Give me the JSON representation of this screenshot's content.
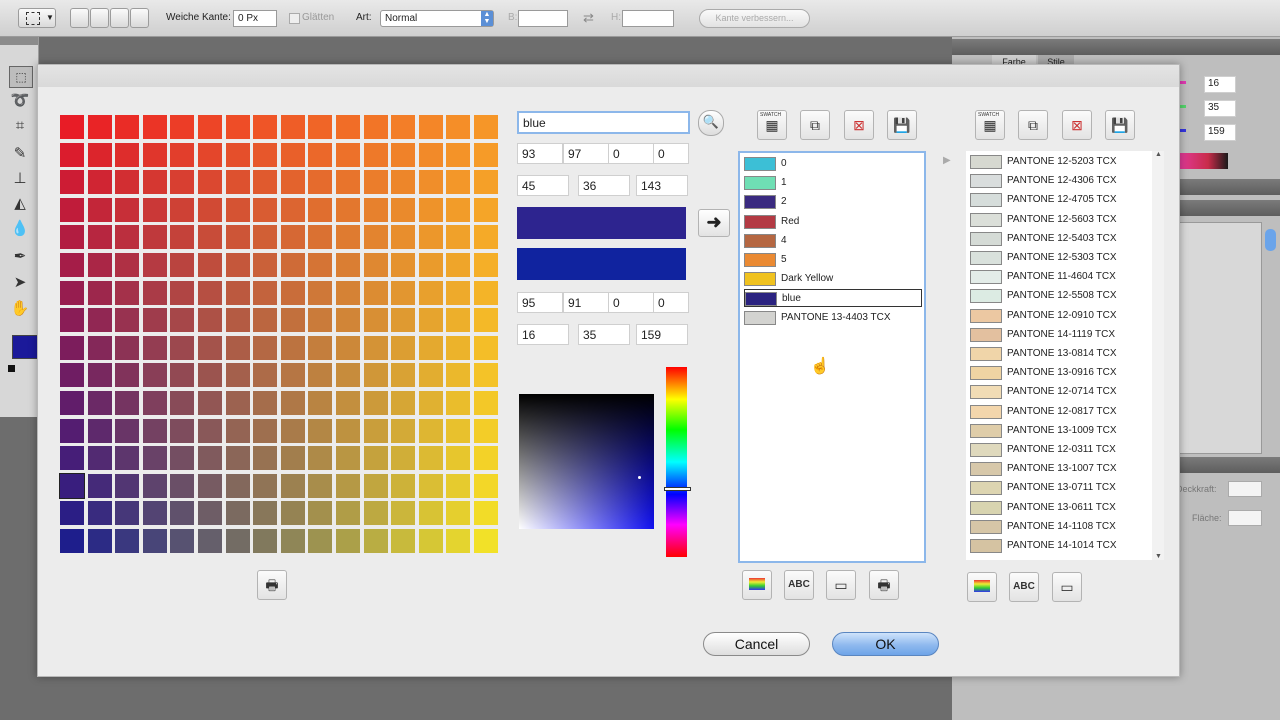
{
  "optbar": {
    "feather_label": "Weiche Kante:",
    "feather_value": "0 Px",
    "smooth_label": "Glätten",
    "style_label": "Art:",
    "style_value": "Normal",
    "width_label": "B:",
    "height_label": "H:",
    "refine_button": "Kante verbessern..."
  },
  "right_panel": {
    "tab_color": "Farbe",
    "tab_styles": "Stile",
    "r_value": "16",
    "g_value": "35",
    "b_value": "159",
    "opacity_label": "Deckkraft:",
    "fill_label": "Fläche:"
  },
  "dialog": {
    "name_value": "blue",
    "cmyk_top": [
      "93",
      "97",
      "0",
      "0"
    ],
    "rgb_top": [
      "45",
      "36",
      "143"
    ],
    "cmyk_bottom": [
      "95",
      "91",
      "0",
      "0"
    ],
    "rgb_bottom": [
      "16",
      "35",
      "159"
    ],
    "color_top": "#2d248f",
    "color_bottom": "#10239f",
    "cancel_label": "Cancel",
    "ok_label": "OK",
    "abc_label": "ABC",
    "swatch_icon_label": "SWATCH"
  },
  "doc_swatches": [
    {
      "label": "0",
      "color": "#3cbfd6"
    },
    {
      "label": "1",
      "color": "#6fdfb4"
    },
    {
      "label": "2",
      "color": "#3a2a80"
    },
    {
      "label": "Red",
      "color": "#b33a44"
    },
    {
      "label": "4",
      "color": "#b56742"
    },
    {
      "label": "5",
      "color": "#ea8a33"
    },
    {
      "label": "Dark Yellow",
      "color": "#f0c21f"
    },
    {
      "label": "blue",
      "color": "#2b2380"
    },
    {
      "label": "PANTONE 13-4403 TCX",
      "color": "#d3d3d0"
    }
  ],
  "library_swatches": [
    {
      "label": "PANTONE 12-5203 TCX",
      "color": "#d6d8d0"
    },
    {
      "label": "PANTONE 12-4306 TCX",
      "color": "#d9dddd"
    },
    {
      "label": "PANTONE 12-4705 TCX",
      "color": "#d6dddb"
    },
    {
      "label": "PANTONE 12-5603 TCX",
      "color": "#dbdfd9"
    },
    {
      "label": "PANTONE 12-5403 TCX",
      "color": "#d5dbd6"
    },
    {
      "label": "PANTONE 12-5303 TCX",
      "color": "#d9e1dc"
    },
    {
      "label": "PANTONE 11-4604 TCX",
      "color": "#e3ece8"
    },
    {
      "label": "PANTONE 12-5508 TCX",
      "color": "#dcebe3"
    },
    {
      "label": "PANTONE 12-0910 TCX",
      "color": "#ecc8a2"
    },
    {
      "label": "PANTONE 14-1119 TCX",
      "color": "#e3c09f"
    },
    {
      "label": "PANTONE 13-0814 TCX",
      "color": "#f0d5a9"
    },
    {
      "label": "PANTONE 13-0916 TCX",
      "color": "#efd4a3"
    },
    {
      "label": "PANTONE 12-0714 TCX",
      "color": "#f1dcb5"
    },
    {
      "label": "PANTONE 12-0817 TCX",
      "color": "#f3d6ac"
    },
    {
      "label": "PANTONE 13-1009 TCX",
      "color": "#dfcda9"
    },
    {
      "label": "PANTONE 12-0311 TCX",
      "color": "#dfd9bd"
    },
    {
      "label": "PANTONE 13-1007 TCX",
      "color": "#d7c8aa"
    },
    {
      "label": "PANTONE 13-0711 TCX",
      "color": "#ddd5b1"
    },
    {
      "label": "PANTONE 13-0611 TCX",
      "color": "#d8d4b0"
    },
    {
      "label": "PANTONE 14-1108 TCX",
      "color": "#d6c6a7"
    },
    {
      "label": "PANTONE 14-1014 TCX",
      "color": "#d5c3a2"
    }
  ],
  "tool_icons": [
    "marquee-icon",
    "lasso-icon",
    "crop-icon",
    "brush-icon",
    "stamp-icon",
    "eraser-icon",
    "blur-icon",
    "pen-icon",
    "arrow-icon",
    "hand-icon"
  ],
  "foreground_color": "#1b199a"
}
